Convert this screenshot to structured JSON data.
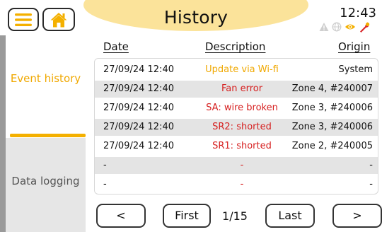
{
  "header": {
    "title": "History",
    "time": "12:43",
    "menu_icon": "hamburger-menu-icon",
    "home_icon": "home-icon",
    "status_icons": [
      "warning-icon",
      "globe-icon",
      "eye-icon",
      "wrench-icon"
    ]
  },
  "sidebar": {
    "items": [
      {
        "label": "Event history",
        "active": true
      },
      {
        "label": "Data logging",
        "active": false
      }
    ]
  },
  "table": {
    "columns": [
      "Date",
      "Description",
      "Origin"
    ],
    "rows": [
      {
        "date": "27/09/24 12:40",
        "description": "Update via Wi-fi",
        "origin": "System",
        "desc_color": "#f0a800"
      },
      {
        "date": "27/09/24 12:40",
        "description": "Fan error",
        "origin": "Zone 4, #240007",
        "desc_color": "#d61f1f"
      },
      {
        "date": "27/09/24 12:40",
        "description": "SA: wire broken",
        "origin": "Zone 3, #240006",
        "desc_color": "#d61f1f"
      },
      {
        "date": "27/09/24 12:40",
        "description": "SR2: shorted",
        "origin": "Zone 3, #240006",
        "desc_color": "#d61f1f"
      },
      {
        "date": "27/09/24 12:40",
        "description": "SR1: shorted",
        "origin": "Zone 2, #240005",
        "desc_color": "#d61f1f"
      },
      {
        "date": "-",
        "description": "-",
        "origin": "-",
        "desc_color": "#d61f1f"
      },
      {
        "date": "-",
        "description": "-",
        "origin": "-",
        "desc_color": "#d61f1f"
      }
    ]
  },
  "pager": {
    "prev": "<",
    "first": "First",
    "page": "1/15",
    "last": "Last",
    "next": ">"
  },
  "colors": {
    "accent": "#f4b000",
    "error": "#d61f1f",
    "info": "#f0a800",
    "header_pill": "#fbe39a"
  }
}
